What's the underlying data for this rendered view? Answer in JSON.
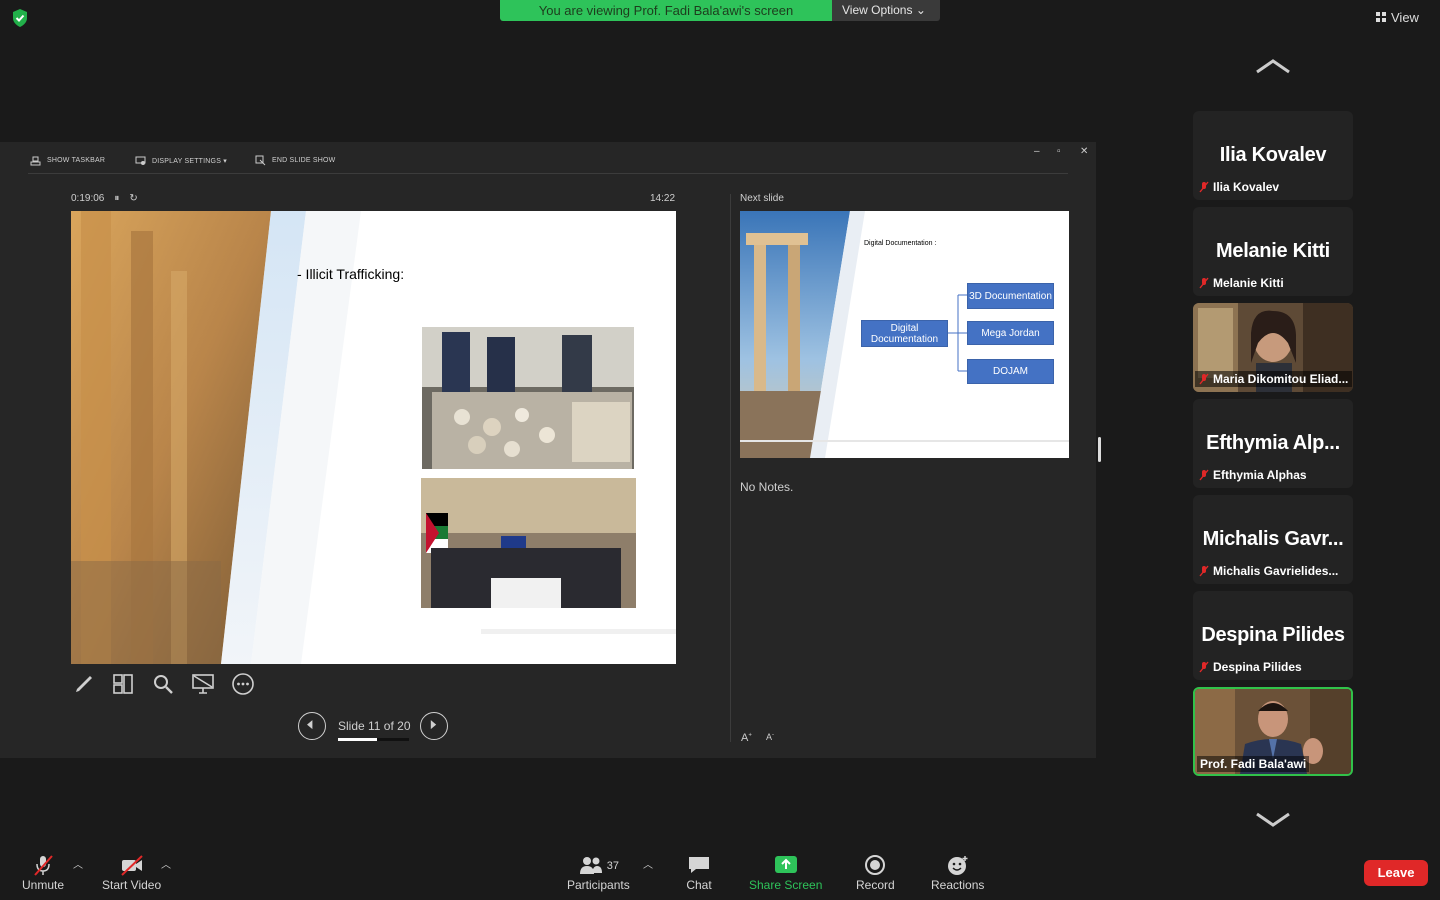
{
  "top": {
    "banner": "You are viewing Prof. Fadi Bala'awi's screen",
    "view_options": "View Options",
    "view": "View"
  },
  "presenter": {
    "toolbar": {
      "show_taskbar": "SHOW TASKBAR",
      "display_settings": "DISPLAY SETTINGS ▾",
      "end_slide_show": "END SLIDE SHOW"
    },
    "elapsed": "0:19:06",
    "clock": "14:22",
    "next_slide_label": "Next slide",
    "notes": "No Notes.",
    "slide_counter": "Slide 11 of 20",
    "slide_progress": 0.55,
    "current_slide": {
      "title": "- Illicit Trafficking:"
    },
    "next_slide": {
      "title": "Digital Documentation :",
      "root_box": "Digital Documentation",
      "boxes": [
        "3D Documentation",
        "Mega Jordan",
        "DOJAM"
      ]
    },
    "font_increase": "A",
    "font_decrease": "A"
  },
  "gallery": [
    {
      "big": "Ilia Kovalev",
      "name": "Ilia Kovalev",
      "muted": true,
      "video": false
    },
    {
      "big": "Melanie Kitti",
      "name": "Melanie Kitti",
      "muted": true,
      "video": false
    },
    {
      "big": "",
      "name": "Maria Dikomitou Eliad...",
      "muted": true,
      "video": true
    },
    {
      "big": "Efthymia Alp...",
      "name": "Efthymia Alphas",
      "muted": true,
      "video": false
    },
    {
      "big": "Michalis Gavr...",
      "name": "Michalis Gavrielides...",
      "muted": true,
      "video": false
    },
    {
      "big": "Despina Pilides",
      "name": "Despina Pilides",
      "muted": true,
      "video": false
    },
    {
      "big": "",
      "name": "Prof. Fadi Bala'awi",
      "muted": false,
      "video": true,
      "active": true
    }
  ],
  "bottom": {
    "unmute": "Unmute",
    "start_video": "Start Video",
    "participants": "Participants",
    "participant_count": "37",
    "chat": "Chat",
    "share_screen": "Share Screen",
    "record": "Record",
    "reactions": "Reactions",
    "leave": "Leave"
  },
  "colors": {
    "banner_green": "#2ec35a",
    "share_green": "#2ec35a",
    "leave_red": "#e02828",
    "smartart_blue": "#4472c4"
  }
}
